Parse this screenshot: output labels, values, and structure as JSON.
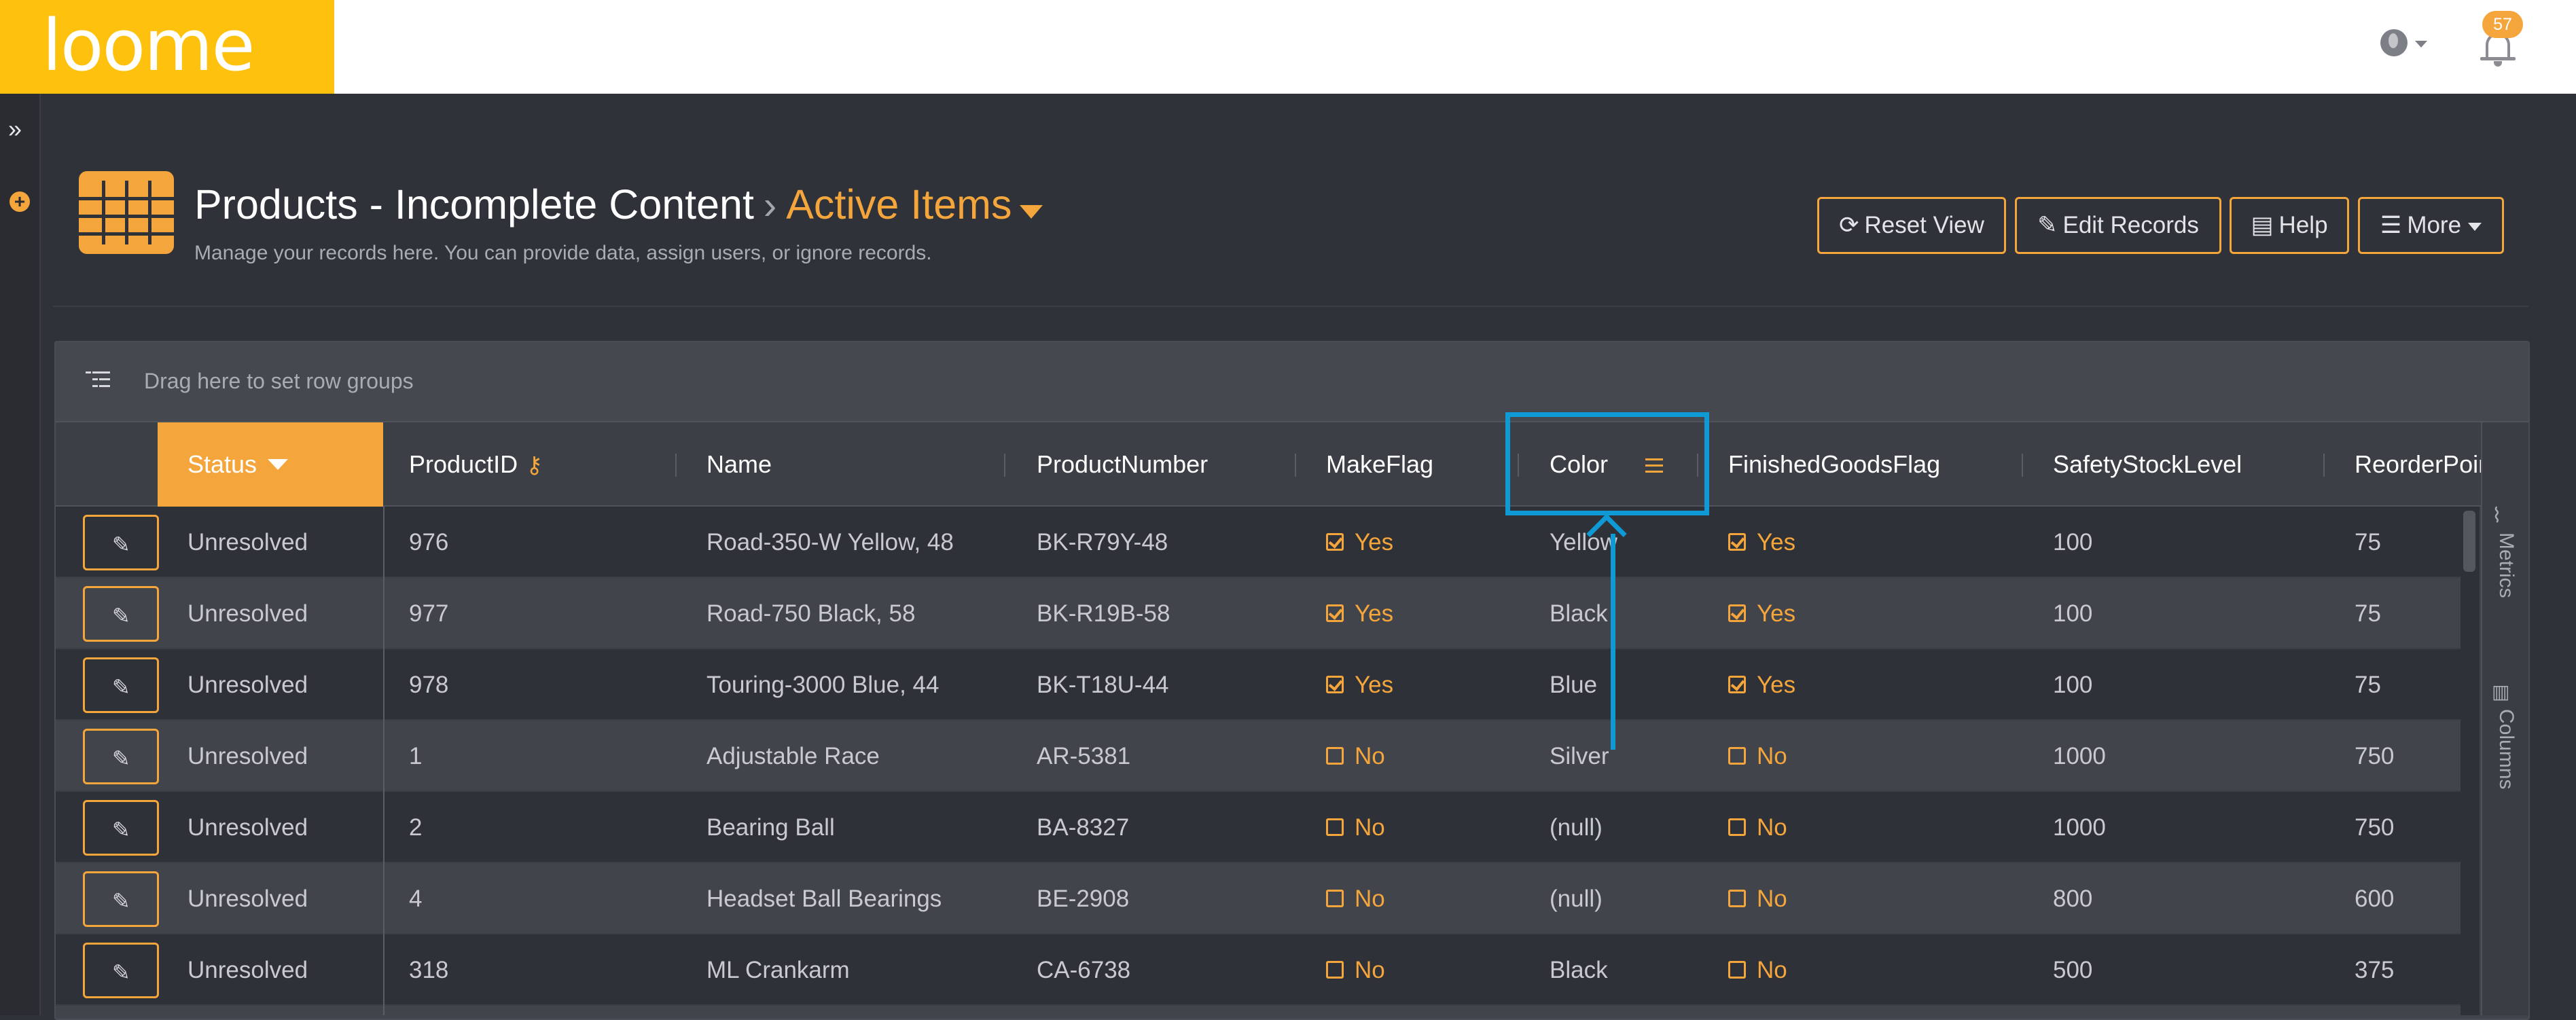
{
  "app": {
    "logo_text": "loome",
    "notification_count": "57"
  },
  "icons": {
    "expand": "double-chevron-right-icon",
    "add": "plus-circle-icon",
    "grid": "table-grid-icon",
    "globe": "globe-icon",
    "bell": "bell-icon"
  },
  "header": {
    "title": "Products - Incomplete Content",
    "breadcrumb_separator": "›",
    "active_view": "Active Items",
    "subtitle": "Manage your records here. You can provide data, assign users, or ignore records."
  },
  "toolbar": {
    "reset_view": "Reset View",
    "edit_records": "Edit Records",
    "help": "Help",
    "more": "More"
  },
  "grid": {
    "group_placeholder": "Drag here to set row groups",
    "columns": {
      "status": "Status",
      "product_id": "ProductID",
      "name": "Name",
      "product_number": "ProductNumber",
      "make_flag": "MakeFlag",
      "color": "Color",
      "finished_goods_flag": "FinishedGoodsFlag",
      "safety_stock_level": "SafetyStockLevel",
      "reorder_point": "ReorderPoint"
    },
    "rows": [
      {
        "status": "Unresolved",
        "product_id": "976",
        "name": "Road-350-W Yellow, 48",
        "product_number": "BK-R79Y-48",
        "make_flag": "Yes",
        "color": "Yellow",
        "finished_goods_flag": "Yes",
        "safety_stock_level": "100",
        "reorder_point": "75"
      },
      {
        "status": "Unresolved",
        "product_id": "977",
        "name": "Road-750 Black, 58",
        "product_number": "BK-R19B-58",
        "make_flag": "Yes",
        "color": "Black",
        "finished_goods_flag": "Yes",
        "safety_stock_level": "100",
        "reorder_point": "75"
      },
      {
        "status": "Unresolved",
        "product_id": "978",
        "name": "Touring-3000 Blue, 44",
        "product_number": "BK-T18U-44",
        "make_flag": "Yes",
        "color": "Blue",
        "finished_goods_flag": "Yes",
        "safety_stock_level": "100",
        "reorder_point": "75"
      },
      {
        "status": "Unresolved",
        "product_id": "1",
        "name": "Adjustable Race",
        "product_number": "AR-5381",
        "make_flag": "No",
        "color": "Silver",
        "finished_goods_flag": "No",
        "safety_stock_level": "1000",
        "reorder_point": "750"
      },
      {
        "status": "Unresolved",
        "product_id": "2",
        "name": "Bearing Ball",
        "product_number": "BA-8327",
        "make_flag": "No",
        "color": "(null)",
        "finished_goods_flag": "No",
        "safety_stock_level": "1000",
        "reorder_point": "750"
      },
      {
        "status": "Unresolved",
        "product_id": "4",
        "name": "Headset Ball Bearings",
        "product_number": "BE-2908",
        "make_flag": "No",
        "color": "(null)",
        "finished_goods_flag": "No",
        "safety_stock_level": "800",
        "reorder_point": "600"
      },
      {
        "status": "Unresolved",
        "product_id": "318",
        "name": "ML Crankarm",
        "product_number": "CA-6738",
        "make_flag": "No",
        "color": "Black",
        "finished_goods_flag": "No",
        "safety_stock_level": "500",
        "reorder_point": "375"
      }
    ]
  },
  "side_panel": {
    "metrics": "Metrics",
    "columns": "Columns"
  },
  "colors": {
    "accent": "#f4a53c",
    "logo_bg": "#fec10d",
    "annotation": "#0f9ad6",
    "background": "#2f3239"
  }
}
